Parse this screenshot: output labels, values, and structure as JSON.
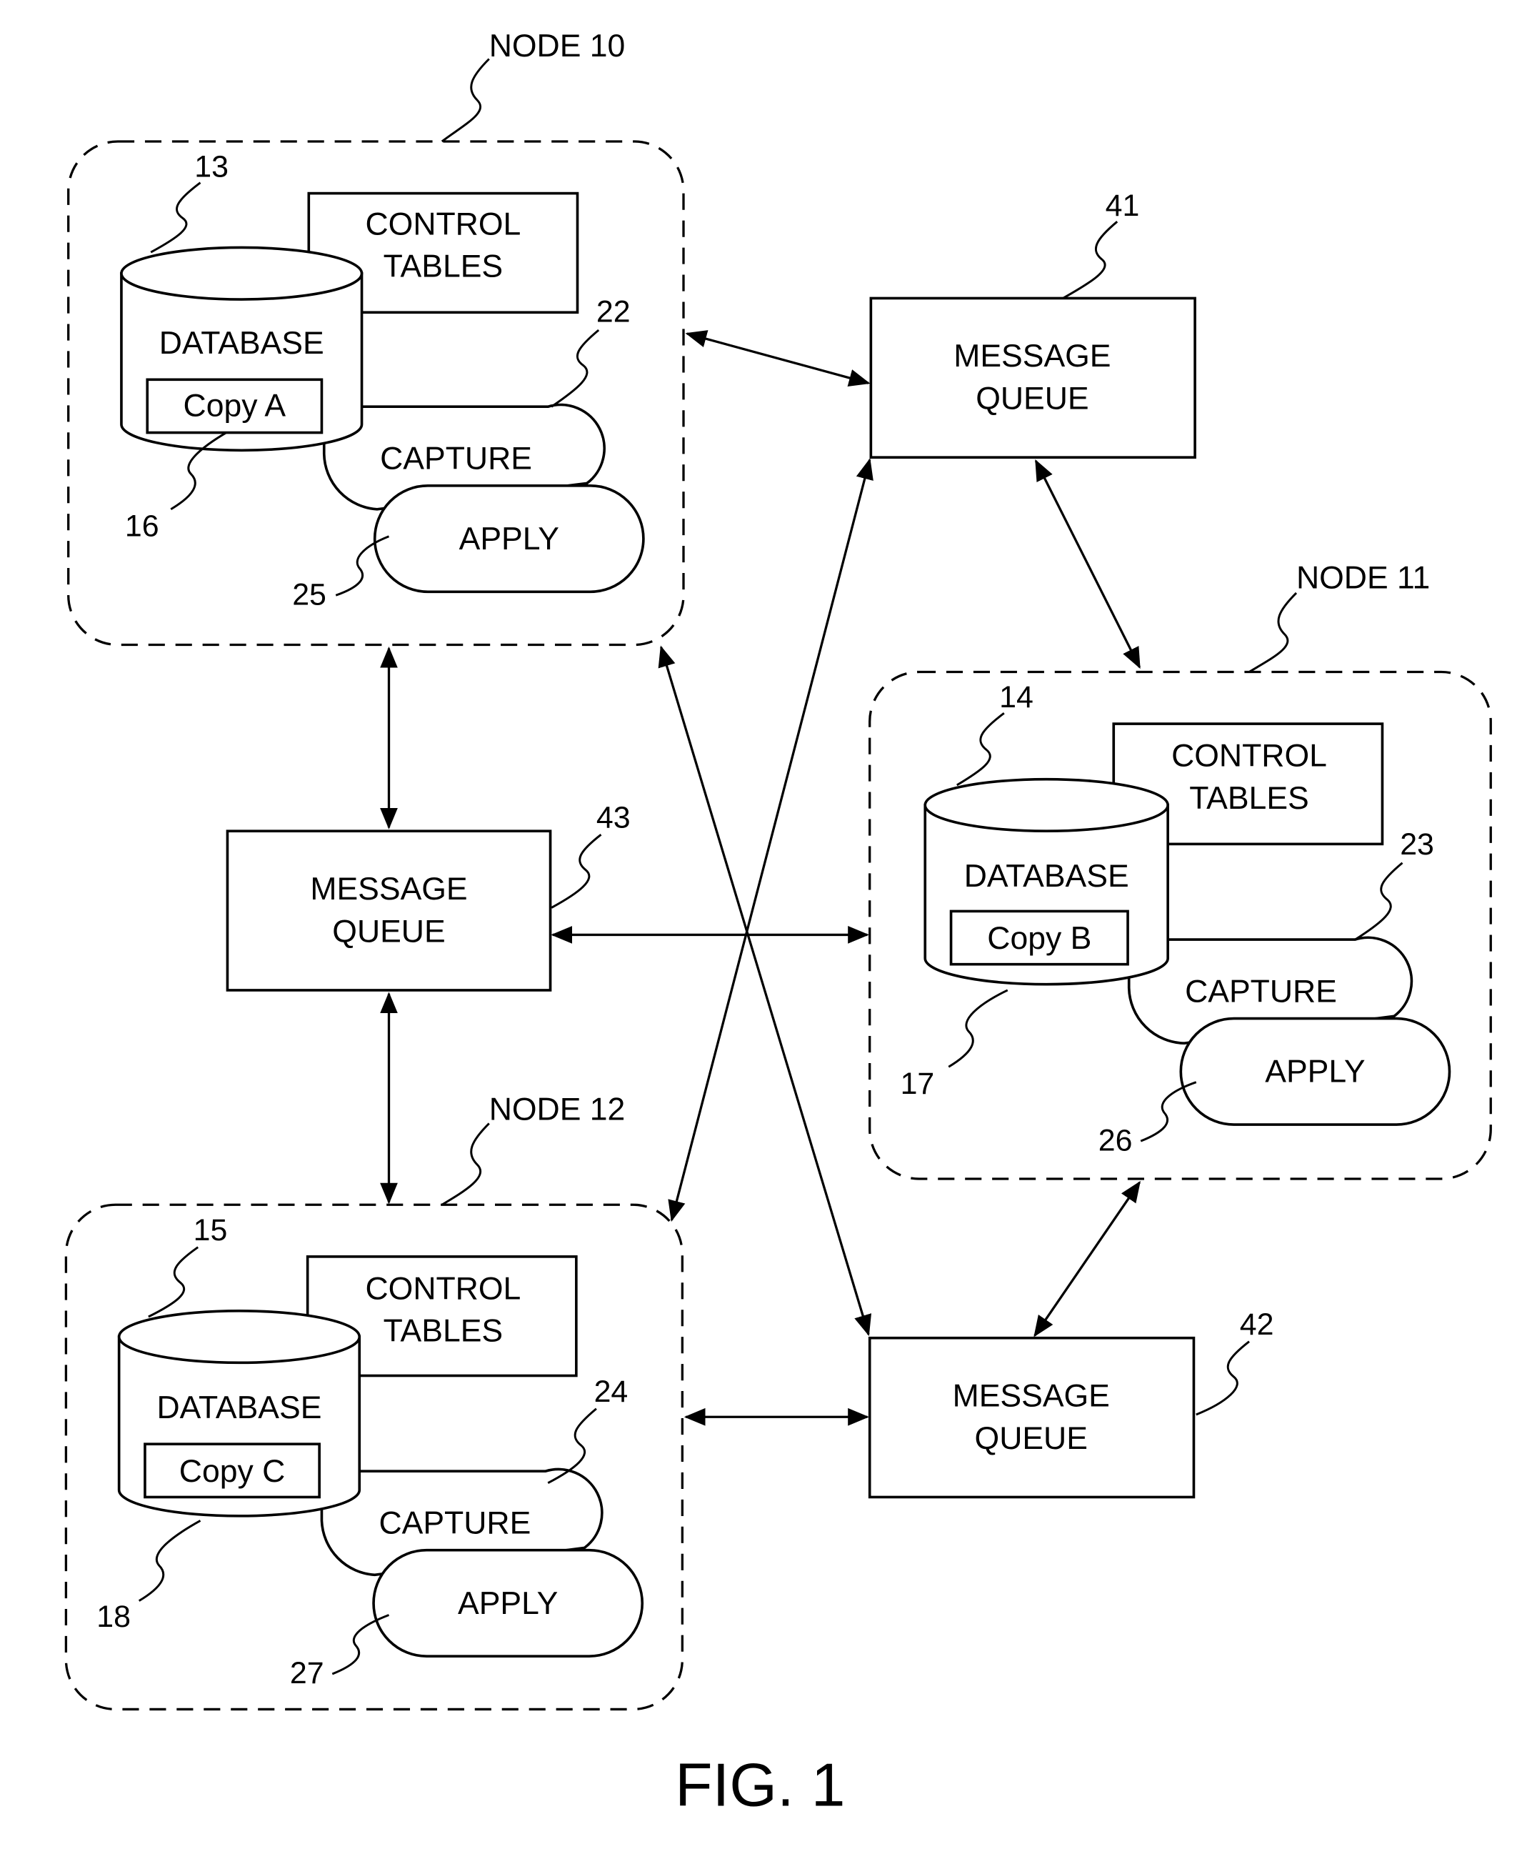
{
  "figure": {
    "caption": "FIG. 1",
    "background_color": "#ffffff",
    "line_color": "#000000"
  },
  "nodes": [
    {
      "id": "node10",
      "label": "NODE 10",
      "database": {
        "ref": "13",
        "label": "DATABASE",
        "copy_label": "Copy A",
        "copy_ref": "16"
      },
      "control_tables": {
        "line1": "CONTROL",
        "line2": "TABLES"
      },
      "capture": {
        "ref": "22",
        "label": "CAPTURE"
      },
      "apply": {
        "ref": "25",
        "label": "APPLY"
      }
    },
    {
      "id": "node11",
      "label": "NODE 11",
      "database": {
        "ref": "14",
        "label": "DATABASE",
        "copy_label": "Copy B",
        "copy_ref": "17"
      },
      "control_tables": {
        "line1": "CONTROL",
        "line2": "TABLES"
      },
      "capture": {
        "ref": "23",
        "label": "CAPTURE"
      },
      "apply": {
        "ref": "26",
        "label": "APPLY"
      }
    },
    {
      "id": "node12",
      "label": "NODE 12",
      "database": {
        "ref": "15",
        "label": "DATABASE",
        "copy_label": "Copy C",
        "copy_ref": "18"
      },
      "control_tables": {
        "line1": "CONTROL",
        "line2": "TABLES"
      },
      "capture": {
        "ref": "24",
        "label": "CAPTURE"
      },
      "apply": {
        "ref": "27",
        "label": "APPLY"
      }
    }
  ],
  "queues": [
    {
      "id": "mq41",
      "ref": "41",
      "line1": "MESSAGE",
      "line2": "QUEUE"
    },
    {
      "id": "mq42",
      "ref": "42",
      "line1": "MESSAGE",
      "line2": "QUEUE"
    },
    {
      "id": "mq43",
      "ref": "43",
      "line1": "MESSAGE",
      "line2": "QUEUE"
    }
  ],
  "connections": [
    {
      "from": "NODE 10",
      "to": "MESSAGE QUEUE 41",
      "bidirectional": true
    },
    {
      "from": "MESSAGE QUEUE 41",
      "to": "NODE 11",
      "bidirectional": true
    },
    {
      "from": "MESSAGE QUEUE 41",
      "to": "NODE 12",
      "bidirectional": true
    },
    {
      "from": "NODE 10",
      "to": "MESSAGE QUEUE 43",
      "bidirectional": true
    },
    {
      "from": "MESSAGE QUEUE 43",
      "to": "NODE 12",
      "bidirectional": true
    },
    {
      "from": "MESSAGE QUEUE 43",
      "to": "NODE 11",
      "bidirectional": true
    },
    {
      "from": "NODE 10",
      "to": "MESSAGE QUEUE 42",
      "bidirectional": true
    },
    {
      "from": "NODE 11",
      "to": "MESSAGE QUEUE 42",
      "bidirectional": true
    },
    {
      "from": "NODE 12",
      "to": "MESSAGE QUEUE 42",
      "bidirectional": true
    }
  ]
}
